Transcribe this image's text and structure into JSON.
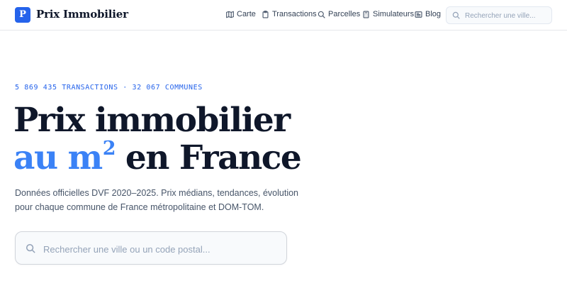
{
  "header": {
    "logo_letter": "P",
    "brand": "Prix Immobilier",
    "nav": [
      {
        "label": "Carte",
        "icon": "map-icon"
      },
      {
        "label": "Transactions",
        "icon": "clipboard-icon"
      },
      {
        "label": "Parcelles",
        "icon": "search-icon"
      },
      {
        "label": "Simulateurs",
        "icon": "calculator-icon"
      },
      {
        "label": "Blog",
        "icon": "newspaper-icon"
      }
    ],
    "search": {
      "placeholder": "Rechercher une ville...",
      "value": ""
    }
  },
  "hero": {
    "stats": "5 869 435 TRANSACTIONS · 32 067 COMMUNES",
    "title_line1": "Prix immobilier",
    "title_line2_accent": "au m",
    "title_line2_sup": "2",
    "title_line2_rest": " en France",
    "lead": "Données officielles DVF 2020–2025. Prix médians, tendances, évolution pour chaque commune de France métropolitaine et DOM-TOM.",
    "search": {
      "placeholder": "Rechercher une ville ou un code postal...",
      "value": ""
    }
  },
  "colors": {
    "accent": "#2563eb",
    "accent_light": "#3b82f6",
    "text": "#0f172a"
  }
}
